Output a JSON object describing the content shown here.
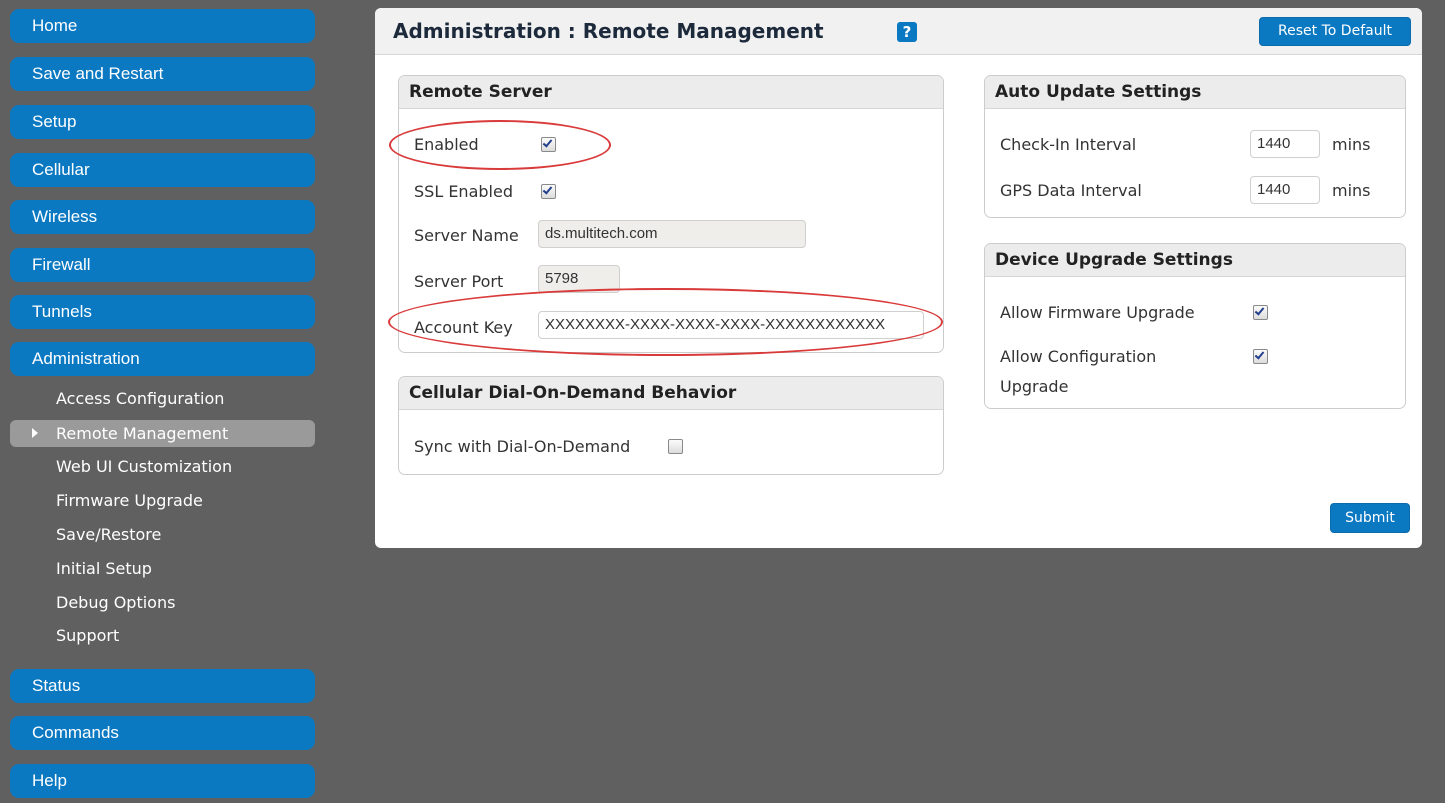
{
  "sidebar": {
    "items": [
      {
        "label": "Home"
      },
      {
        "label": "Save and Restart"
      },
      {
        "label": "Setup"
      },
      {
        "label": "Cellular"
      },
      {
        "label": "Wireless"
      },
      {
        "label": "Firewall"
      },
      {
        "label": "Tunnels"
      },
      {
        "label": "Administration"
      }
    ],
    "subitems": [
      {
        "label": "Access Configuration"
      },
      {
        "label": "Remote Management"
      },
      {
        "label": "Web UI Customization"
      },
      {
        "label": "Firmware Upgrade"
      },
      {
        "label": "Save/Restore"
      },
      {
        "label": "Initial Setup"
      },
      {
        "label": "Debug Options"
      },
      {
        "label": "Support"
      }
    ],
    "bottom_items": [
      {
        "label": "Status"
      },
      {
        "label": "Commands"
      },
      {
        "label": "Help"
      }
    ]
  },
  "header": {
    "title": "Administration : Remote Management",
    "help": "?",
    "reset_label": "Reset To Default"
  },
  "remote_server": {
    "title": "Remote Server",
    "enabled_label": "Enabled",
    "enabled_checked": true,
    "ssl_label": "SSL Enabled",
    "ssl_checked": true,
    "server_name_label": "Server Name",
    "server_name_value": "ds.multitech.com",
    "server_port_label": "Server Port",
    "server_port_value": "5798",
    "account_key_label": "Account Key",
    "account_key_value": "XXXXXXXX-XXXX-XXXX-XXXX-XXXXXXXXXXXX"
  },
  "dial_on_demand": {
    "title": "Cellular Dial-On-Demand Behavior",
    "sync_label": "Sync with Dial-On-Demand",
    "sync_checked": false
  },
  "auto_update": {
    "title": "Auto Update Settings",
    "checkin_label": "Check-In Interval",
    "checkin_value": "1440",
    "checkin_unit": "mins",
    "gps_label": "GPS Data Interval",
    "gps_value": "1440",
    "gps_unit": "mins"
  },
  "device_upgrade": {
    "title": "Device Upgrade Settings",
    "firmware_label": "Allow Firmware Upgrade",
    "firmware_checked": true,
    "config_label_line1": "Allow Configuration",
    "config_label_line2": "Upgrade",
    "config_checked": true
  },
  "submit_label": "Submit",
  "colors": {
    "nav_blue": "#0b78c2",
    "background": "#606060",
    "annotation_red": "#d93a3a"
  }
}
